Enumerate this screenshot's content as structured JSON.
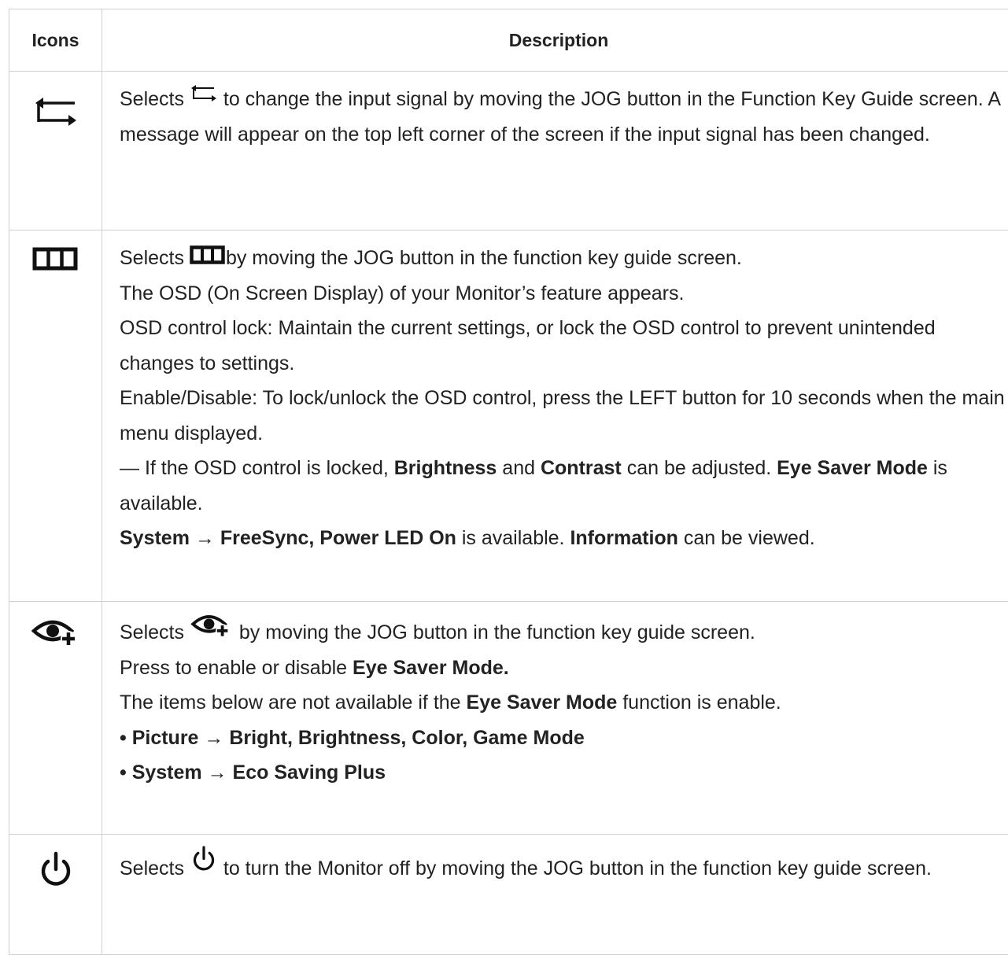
{
  "table": {
    "headers": {
      "icons": "Icons",
      "description": "Description"
    },
    "rows": [
      {
        "icon": "input-source-icon",
        "lines": [
          {
            "pre": "Selects",
            "post": "to change the input signal by moving the JOG button in the Function Key Guide screen. A message will appear on the top left corner of the screen if the input signal has been changed."
          }
        ]
      },
      {
        "icon": "menu-icon",
        "lines": [
          {
            "pre": "Selects",
            "post": "by moving the JOG button in the function key guide screen."
          },
          {
            "text": "The OSD (On Screen Display) of your Monitor’s feature appears."
          },
          {
            "text": "OSD control lock: Maintain the current settings, or lock the OSD control to prevent unintended changes to settings."
          },
          {
            "text": "Enable/Disable: To lock/unlock the OSD control, press the LEFT button for 10 seconds when the main menu displayed."
          },
          {
            "s1": "— If the OSD control is locked, ",
            "b1": "Brightness",
            "s2": " and ",
            "b2": "Contrast",
            "s3": " can be adjusted. ",
            "b3": "Eye Saver Mode",
            "s4": " is available."
          },
          {
            "b1": "System → FreeSync, Power LED On",
            "s1": " is available. ",
            "b2": "Information",
            "s2": " can be viewed."
          }
        ]
      },
      {
        "icon": "eye-saver-icon",
        "lines": [
          {
            "pre": "Selects",
            "post": "by moving the JOG button in the function key guide screen."
          },
          {
            "s1": "Press to enable or disable ",
            "b1": "Eye Saver Mode."
          },
          {
            "s1": "The items below are not available if the ",
            "b1": "Eye Saver Mode",
            "s2": " function is enable."
          },
          {
            "b1": "• Picture → Bright, Brightness, Color, Game Mode"
          },
          {
            "b1": "• System → Eco Saving Plus"
          }
        ]
      },
      {
        "icon": "power-icon",
        "lines": [
          {
            "pre": "Selects",
            "post": "to turn the Monitor off by moving the JOG button in the function key guide screen."
          }
        ]
      }
    ]
  }
}
